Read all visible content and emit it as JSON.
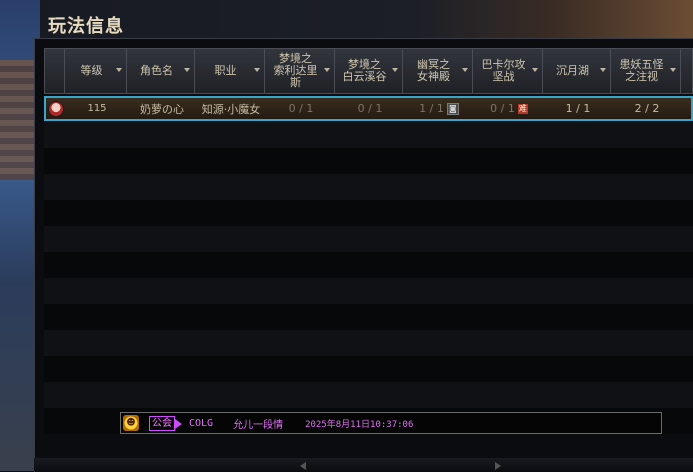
{
  "window": {
    "title": "玩法信息"
  },
  "columns": [
    {
      "label": "等级",
      "width": 62
    },
    {
      "label": "角色名",
      "width": 68
    },
    {
      "label": "职业",
      "width": 70
    },
    {
      "label": "梦境之\n索利达里\n斯",
      "width": 70
    },
    {
      "label": "梦境之\n白云溪谷",
      "width": 68
    },
    {
      "label": "幽冥之\n女神殿",
      "width": 70
    },
    {
      "label": "巴卡尔攻\n坚战",
      "width": 70
    },
    {
      "label": "沉月湖",
      "width": 68
    },
    {
      "label": "患妖五怪\n之注视",
      "width": 70
    }
  ],
  "rows": [
    {
      "level": "115",
      "name": "奶萝の心",
      "job": "知源·小魔女",
      "soridaris": "0 / 1",
      "baiyun": "0 / 1",
      "goddess": "1 / 1",
      "goddess_badge": "◙",
      "bakal": "0 / 1",
      "bakal_badge": "难",
      "moonlake": "1 / 1",
      "five_monsters": "2 / 2"
    }
  ],
  "chat": {
    "icon": "smiley-icon",
    "channel": "公会",
    "sender": "COLG",
    "message": "允儿一段情",
    "timestamp": "2025年8月11日10:37:06"
  },
  "colors": {
    "selection_border": "#36a7c9",
    "guild_tag": "#d24cff"
  }
}
